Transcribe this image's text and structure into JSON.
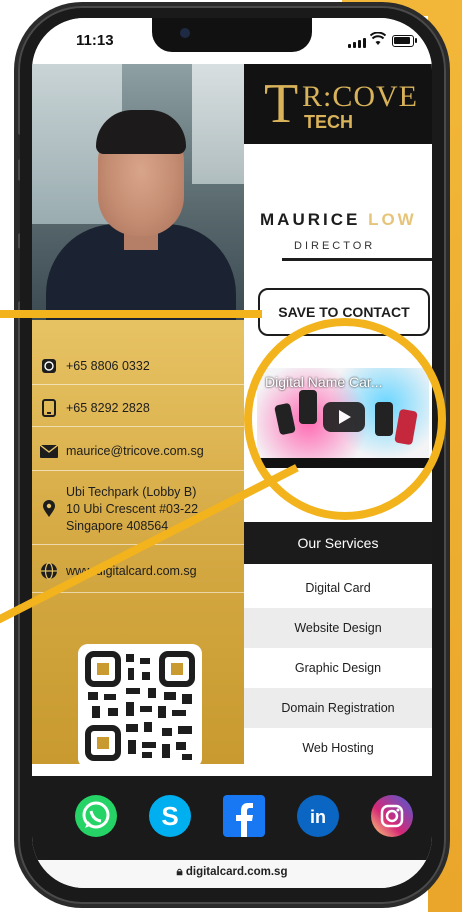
{
  "status_bar": {
    "time": "11:13"
  },
  "brand": {
    "logo_letters": "T",
    "logo_name": "R:COVE",
    "logo_sub": "TECH"
  },
  "profile": {
    "first_name": "MAURICE",
    "last_name": "LOW",
    "title": "DIRECTOR"
  },
  "actions": {
    "save_contact": "SAVE TO CONTACT"
  },
  "contacts": {
    "whatsapp": "+65 8806 0332",
    "phone": "+65 8292 2828",
    "email": "maurice@tricove.com.sg",
    "address_line1": "Ubi Techpark (Lobby B)",
    "address_line2": "10 Ubi Crescent #03-22",
    "address_line3": "Singapore 408564",
    "website": "www.digitalcard.com.sg"
  },
  "video": {
    "title": "Digital Name Car..."
  },
  "services": {
    "heading": "Our Services",
    "items": [
      "Digital Card",
      "Website Design",
      "Graphic Design",
      "Domain Registration",
      "Web Hosting"
    ]
  },
  "social": [
    "whatsapp-icon",
    "skype-icon",
    "facebook-icon",
    "linkedin-icon",
    "instagram-icon"
  ],
  "browser": {
    "url": "digitalcard.com.sg"
  },
  "colors": {
    "accent_gold": "#f2b31d",
    "dark": "#1a1a1a",
    "card_gold": "#e8c465"
  }
}
